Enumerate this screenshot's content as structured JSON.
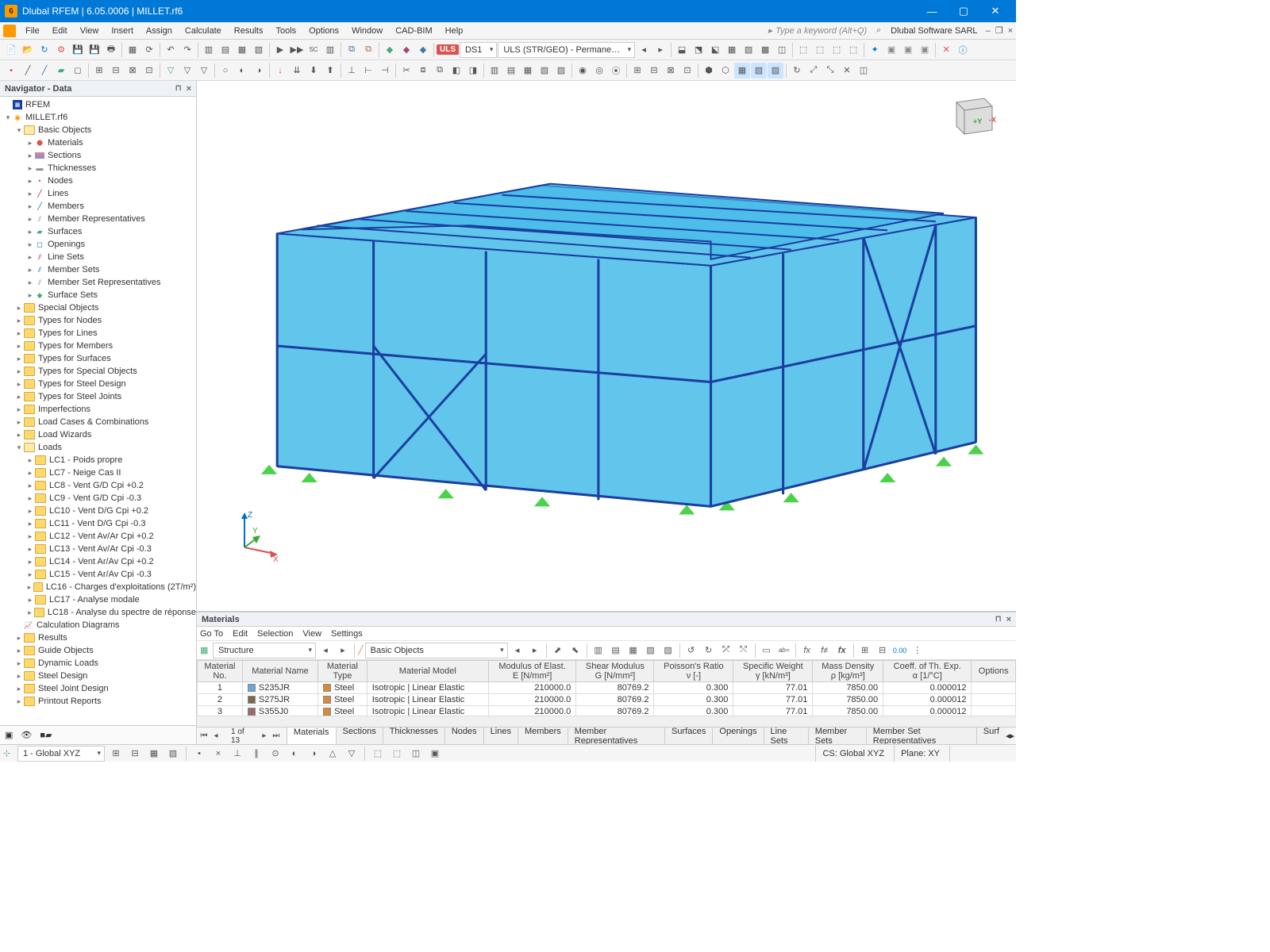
{
  "titlebar": {
    "text": "Dlubal RFEM | 6.05.0006 | MILLET.rf6"
  },
  "menu": [
    "File",
    "Edit",
    "View",
    "Insert",
    "Assign",
    "Calculate",
    "Results",
    "Tools",
    "Options",
    "Window",
    "CAD-BIM",
    "Help"
  ],
  "search_placeholder": "Type a keyword (Alt+Q)",
  "company": "Dlubal Software SARL",
  "toolbar_combo": {
    "uls": "ULS",
    "ds1": "DS1",
    "combo_main": "ULS (STR/GEO) - Permane…"
  },
  "nav": {
    "title": "Navigator - Data",
    "root": "RFEM",
    "model": "MILLET.rf6",
    "basic_objects_label": "Basic Objects",
    "basic": [
      "Materials",
      "Sections",
      "Thicknesses",
      "Nodes",
      "Lines",
      "Members",
      "Member Representatives",
      "Surfaces",
      "Openings",
      "Line Sets",
      "Member Sets",
      "Member Set Representatives",
      "Surface Sets"
    ],
    "folders": [
      "Special Objects",
      "Types for Nodes",
      "Types for Lines",
      "Types for Members",
      "Types for Surfaces",
      "Types for Special Objects",
      "Types for Steel Design",
      "Types for Steel Joints",
      "Imperfections",
      "Load Cases & Combinations",
      "Load Wizards"
    ],
    "loads_label": "Loads",
    "loads": [
      "LC1 - Poids propre",
      "LC7 - Neige Cas II",
      "LC8 - Vent G/D Cpi +0.2",
      "LC9 - Vent G/D Cpi -0.3",
      "LC10 - Vent D/G Cpi +0.2",
      "LC11 - Vent D/G Cpi -0.3",
      "LC12 - Vent Av/Ar Cpi +0.2",
      "LC13 - Vent Av/Ar Cpi -0.3",
      "LC14 - Vent Ar/Av Cpi +0.2",
      "LC15 - Vent Ar/Av Cpi -0.3",
      "LC16 - Charges d'exploitations (2T/m²)",
      "LC17 - Analyse modale",
      "LC18 - Analyse du spectre de réponse"
    ],
    "calc_diag": "Calculation Diagrams",
    "tail": [
      "Results",
      "Guide Objects",
      "Dynamic Loads",
      "Steel Design",
      "Steel Joint Design",
      "Printout Reports"
    ]
  },
  "materials_panel": {
    "title": "Materials",
    "menu": [
      "Go To",
      "Edit",
      "Selection",
      "View",
      "Settings"
    ],
    "structure_label": "Structure",
    "basic_label": "Basic Objects",
    "headers": [
      "Material\nNo.",
      "Material Name",
      "Material\nType",
      "Material Model",
      "Modulus of Elast.\nE [N/mm²]",
      "Shear Modulus\nG [N/mm²]",
      "Poisson's Ratio\nν [-]",
      "Specific Weight\nγ [kN/m³]",
      "Mass Density\nρ [kg/m³]",
      "Coeff. of Th. Exp.\nα [1/°C]",
      "Options"
    ],
    "rows": [
      {
        "no": 1,
        "name": "S235JR",
        "swatch": "#6aa6d8",
        "type": "Steel",
        "type_sw": "#d88a3a",
        "model": "Isotropic | Linear Elastic",
        "E": "210000.0",
        "G": "80769.2",
        "nu": "0.300",
        "gamma": "77.01",
        "rho": "7850.00",
        "alpha": "0.000012"
      },
      {
        "no": 2,
        "name": "S275JR",
        "swatch": "#7a6a4a",
        "type": "Steel",
        "type_sw": "#d88a3a",
        "model": "Isotropic | Linear Elastic",
        "E": "210000.0",
        "G": "80769.2",
        "nu": "0.300",
        "gamma": "77.01",
        "rho": "7850.00",
        "alpha": "0.000012"
      },
      {
        "no": 3,
        "name": "S355J0",
        "swatch": "#9a6a6a",
        "type": "Steel",
        "type_sw": "#d88a3a",
        "model": "Isotropic | Linear Elastic",
        "E": "210000.0",
        "G": "80769.2",
        "nu": "0.300",
        "gamma": "77.01",
        "rho": "7850.00",
        "alpha": "0.000012"
      }
    ],
    "pager": "1 of 13",
    "tabs": [
      "Materials",
      "Sections",
      "Thicknesses",
      "Nodes",
      "Lines",
      "Members",
      "Member Representatives",
      "Surfaces",
      "Openings",
      "Line Sets",
      "Member Sets",
      "Member Set Representatives",
      "Surf"
    ]
  },
  "status": {
    "cs_label": "1 - Global XYZ",
    "cs": "CS: Global XYZ",
    "plane": "Plane: XY"
  }
}
